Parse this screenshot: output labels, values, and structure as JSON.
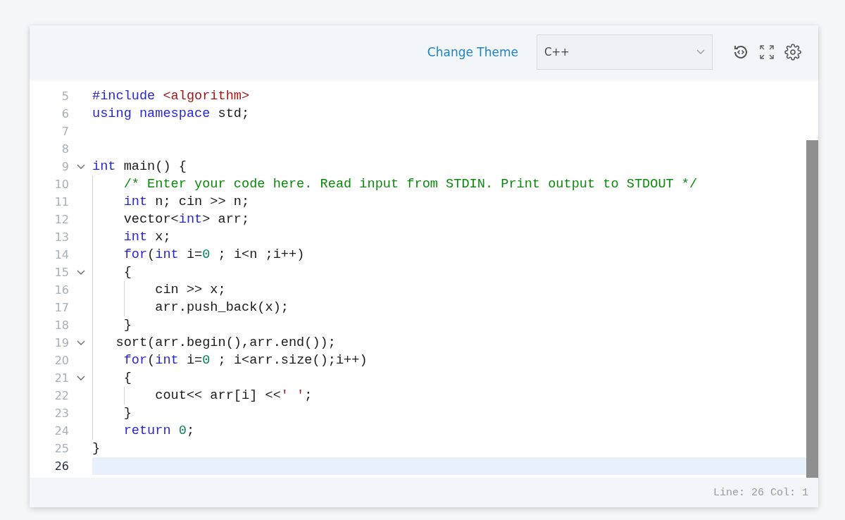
{
  "toolbar": {
    "theme_link": "Change Theme",
    "language_select": {
      "value": "C++"
    }
  },
  "editor": {
    "lines": [
      {
        "number": "5",
        "foldable": false,
        "active": false,
        "tokens": [
          {
            "kind": "keyword",
            "text": "#include"
          },
          {
            "kind": "string",
            "text": " <algorithm>"
          }
        ]
      },
      {
        "number": "6",
        "foldable": false,
        "active": false,
        "tokens": [
          {
            "kind": "keyword",
            "text": "using namespace"
          },
          {
            "kind": "plain",
            "text": " std;"
          }
        ]
      },
      {
        "number": "7",
        "foldable": false,
        "active": false
      },
      {
        "number": "8",
        "foldable": false,
        "active": false
      },
      {
        "number": "9",
        "foldable": true,
        "active": false,
        "tokens": [
          {
            "kind": "keyword",
            "text": "int"
          },
          {
            "kind": "plain",
            "text": " main() {"
          }
        ]
      },
      {
        "number": "10",
        "foldable": false,
        "active": false,
        "tokens": [
          {
            "kind": "comment",
            "text": "    /* Enter your code here. Read input from STDIN. Print output to STDOUT */"
          }
        ]
      },
      {
        "number": "11",
        "foldable": false,
        "active": false,
        "tokens": [
          {
            "kind": "keyword",
            "text": "    int"
          },
          {
            "kind": "plain",
            "text": " n; cin >> n;"
          }
        ]
      },
      {
        "number": "12",
        "foldable": false,
        "active": false,
        "tokens": [
          {
            "kind": "plain",
            "text": "    vector<"
          },
          {
            "kind": "keyword",
            "text": "int"
          },
          {
            "kind": "plain",
            "text": "> arr;"
          }
        ]
      },
      {
        "number": "13",
        "foldable": false,
        "active": false,
        "tokens": [
          {
            "kind": "keyword",
            "text": "    int"
          },
          {
            "kind": "plain",
            "text": " x;"
          }
        ]
      },
      {
        "number": "14",
        "foldable": false,
        "active": false,
        "tokens": [
          {
            "kind": "keyword",
            "text": "    for"
          },
          {
            "kind": "plain",
            "text": "("
          },
          {
            "kind": "keyword",
            "text": "int"
          },
          {
            "kind": "plain",
            "text": " i="
          },
          {
            "kind": "number",
            "text": "0"
          },
          {
            "kind": "plain",
            "text": " ; i<n ;i++)"
          }
        ]
      },
      {
        "number": "15",
        "foldable": true,
        "active": false,
        "tokens": [
          {
            "kind": "plain",
            "text": "    {"
          }
        ]
      },
      {
        "number": "16",
        "foldable": false,
        "active": false,
        "tokens": [
          {
            "kind": "plain",
            "text": "        cin >> x;"
          }
        ]
      },
      {
        "number": "17",
        "foldable": false,
        "active": false,
        "tokens": [
          {
            "kind": "plain",
            "text": "        arr.push_back(x);"
          }
        ]
      },
      {
        "number": "18",
        "foldable": false,
        "active": false,
        "tokens": [
          {
            "kind": "plain",
            "text": "    }"
          }
        ]
      },
      {
        "number": "19",
        "foldable": true,
        "active": false,
        "tokens": [
          {
            "kind": "plain",
            "text": "   sort(arr.begin(),arr.end());"
          }
        ]
      },
      {
        "number": "20",
        "foldable": false,
        "active": false,
        "tokens": [
          {
            "kind": "keyword",
            "text": "    for"
          },
          {
            "kind": "plain",
            "text": "("
          },
          {
            "kind": "keyword",
            "text": "int"
          },
          {
            "kind": "plain",
            "text": " i="
          },
          {
            "kind": "number",
            "text": "0"
          },
          {
            "kind": "plain",
            "text": " ; i<arr.size();i++)"
          }
        ]
      },
      {
        "number": "21",
        "foldable": true,
        "active": false,
        "tokens": [
          {
            "kind": "plain",
            "text": "    {"
          }
        ]
      },
      {
        "number": "22",
        "foldable": false,
        "active": false,
        "tokens": [
          {
            "kind": "plain",
            "text": "        cout<< arr[i] <<"
          },
          {
            "kind": "string",
            "text": "' '"
          },
          {
            "kind": "plain",
            "text": ";"
          }
        ]
      },
      {
        "number": "23",
        "foldable": false,
        "active": false,
        "tokens": [
          {
            "kind": "plain",
            "text": "    }"
          }
        ]
      },
      {
        "number": "24",
        "foldable": false,
        "active": false,
        "tokens": [
          {
            "kind": "keyword",
            "text": "    return"
          },
          {
            "kind": "number",
            "text": " 0"
          },
          {
            "kind": "plain",
            "text": ";"
          }
        ]
      },
      {
        "number": "25",
        "foldable": false,
        "active": false,
        "tokens": [
          {
            "kind": "plain",
            "text": "}"
          }
        ]
      },
      {
        "number": "26",
        "foldable": false,
        "active": true
      }
    ]
  },
  "status_bar": "Line: 26 Col: 1"
}
